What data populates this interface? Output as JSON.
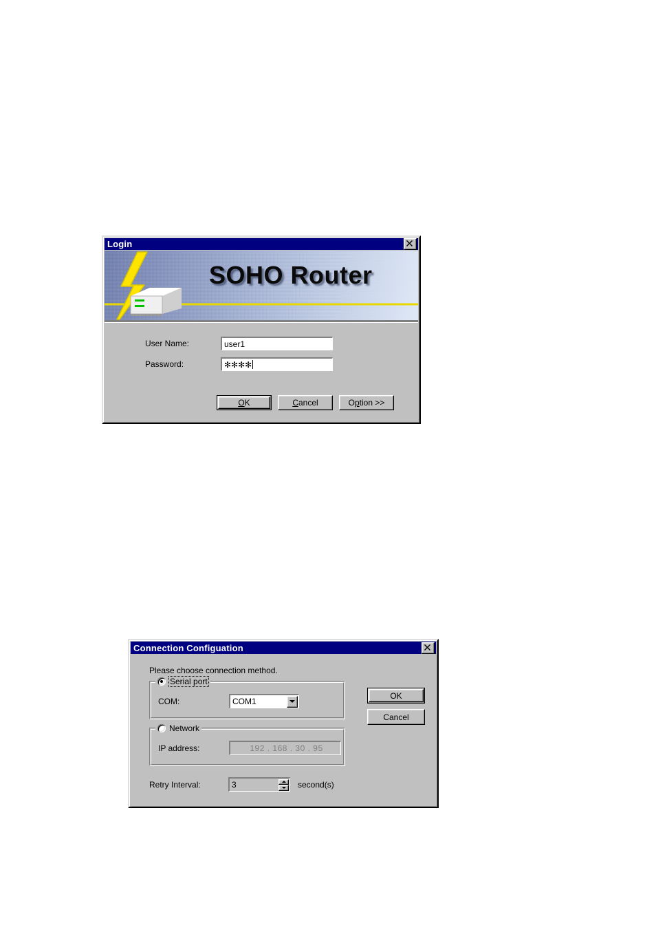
{
  "login_dialog": {
    "title": "Login",
    "close_label": "Close",
    "banner": {
      "product_name": "SOHO Router",
      "bolt_color": "#ffe400",
      "device_led_color": "#00c000",
      "gradient_from": "#6878a8",
      "gradient_to": "#dde6f4"
    },
    "fields": {
      "username_label": "User Name:",
      "username_value": "user1",
      "username_placeholder": "",
      "password_label": "Password:",
      "password_value": "****",
      "password_mask": "✻✻✻✻",
      "password_placeholder": ""
    },
    "buttons": {
      "ok": "OK",
      "ok_accel": "O",
      "ok_rest": "K",
      "cancel_accel": "C",
      "cancel_rest": "ancel",
      "option_pre": "O",
      "option_accel": "p",
      "option_rest": "tion >>"
    }
  },
  "connection_dialog": {
    "title": "Connection Configuation",
    "close_label": "Close",
    "prompt": "Please choose connection method.",
    "serial_group": {
      "legend": "Serial port",
      "selected": true,
      "com_label": "COM:",
      "com_value": "COM1",
      "com_options": [
        "COM1"
      ]
    },
    "network_group": {
      "legend": "Network",
      "selected": false,
      "ip_label": "IP address:",
      "ip_value": "192 . 168 . 30 . 95",
      "ip_disabled": true
    },
    "retry": {
      "label": "Retry Interval:",
      "value": "3",
      "unit": "second(s)"
    },
    "buttons": {
      "ok": "OK",
      "cancel": "Cancel"
    }
  },
  "theme": {
    "titlebar_bg": "#000080",
    "dialog_bg": "#c0c0c0",
    "page_bg": "#ffffff",
    "text": "#000000",
    "disabled_text": "#808080"
  }
}
